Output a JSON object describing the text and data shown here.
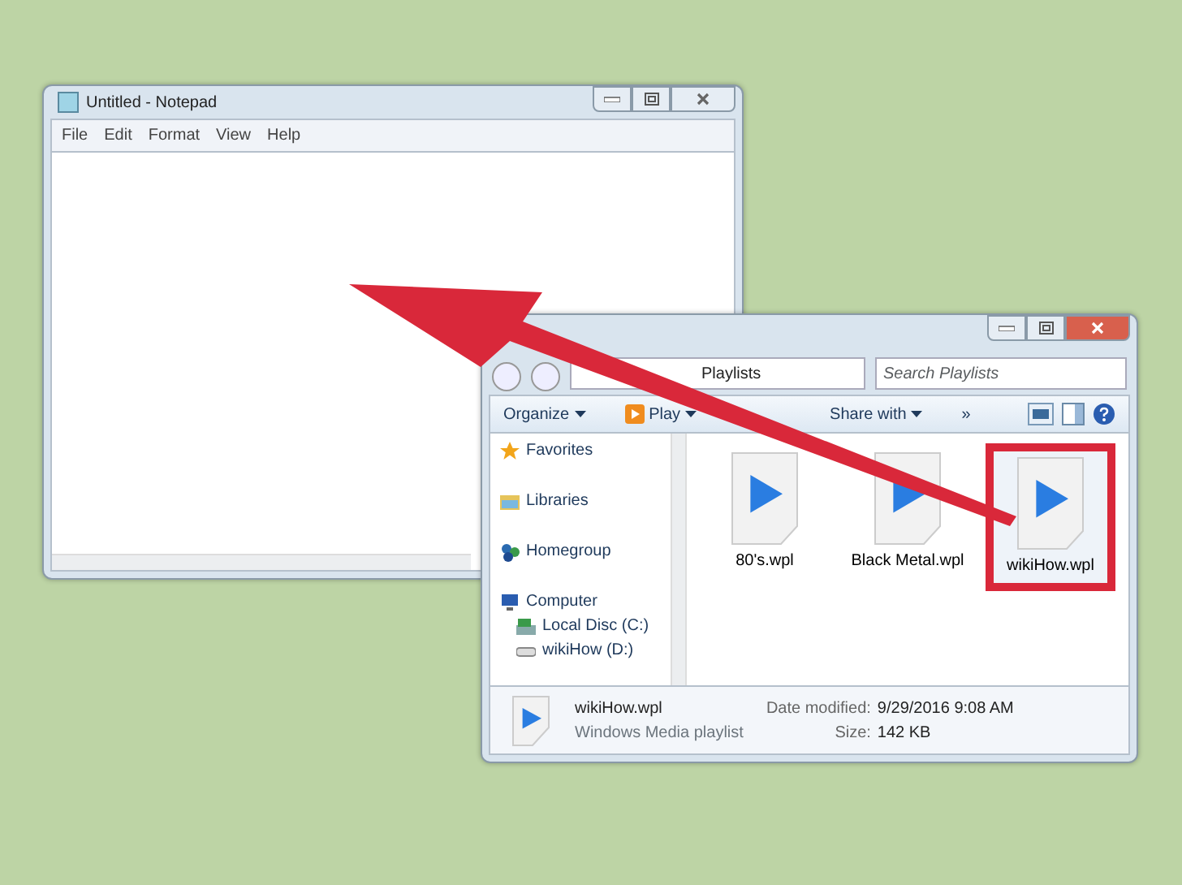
{
  "notepad": {
    "title": "Untitled - Notepad",
    "menu": [
      "File",
      "Edit",
      "Format",
      "View",
      "Help"
    ]
  },
  "explorer": {
    "address": "Playlists",
    "search": {
      "placeholder": "Search Playlists"
    },
    "toolbar": [
      {
        "label": "Organize",
        "kind": "menu"
      },
      {
        "label": "Play",
        "kind": "play"
      },
      {
        "label": "Share with",
        "kind": "menu"
      },
      {
        "label": "»",
        "kind": "more"
      }
    ],
    "nav": [
      {
        "label": "Favorites",
        "kind": "star"
      },
      {
        "label": "Libraries",
        "kind": "library"
      },
      {
        "label": "Homegroup",
        "kind": "homegroup"
      },
      {
        "label": "Computer",
        "kind": "computer",
        "children": [
          {
            "label": "Local Disc (C:)",
            "kind": "disk"
          },
          {
            "label": "wikiHow (D:)",
            "kind": "drive"
          }
        ]
      }
    ],
    "files": [
      {
        "name": "80's.wpl",
        "highlighted": false
      },
      {
        "name": "Black Metal.wpl",
        "highlighted": false
      },
      {
        "name": "wikiHow.wpl",
        "highlighted": true
      }
    ],
    "details": {
      "name": "wikiHow.wpl",
      "type": "Windows Media playlist",
      "date_label": "Date modified:",
      "date_value": "9/29/2016 9:08 AM",
      "size_label": "Size:",
      "size_value": "142 KB"
    }
  }
}
